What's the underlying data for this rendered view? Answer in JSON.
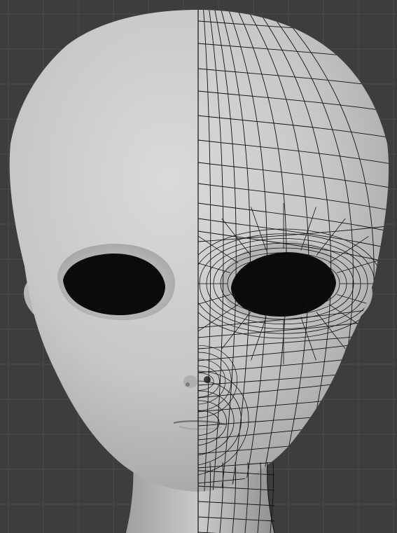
{
  "viewport": {
    "background_color": "#3d3d3d",
    "grid_color": "#4a4a4a",
    "view_mode_left": "solid",
    "view_mode_right": "solid-wireframe"
  },
  "model": {
    "subject": "alien-head",
    "skin_color": "#c8c9ca",
    "skin_shadow_color": "#8e8f90",
    "eye_color": "#0b0b0b",
    "wire_color": "#101010",
    "symmetry": "mirrored"
  }
}
